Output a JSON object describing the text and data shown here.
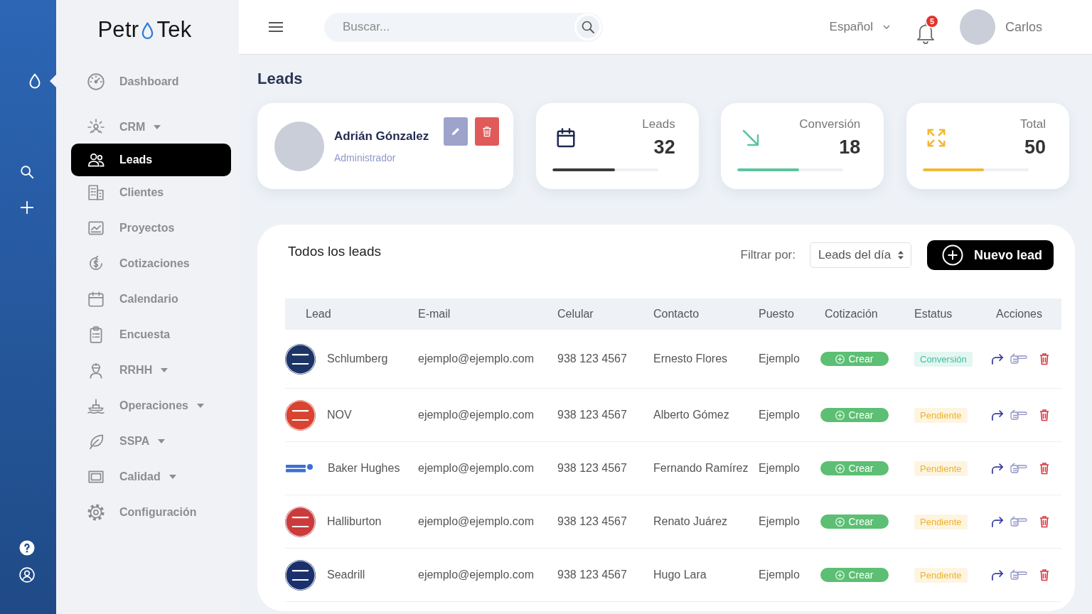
{
  "rail_items": [
    {
      "selected": true
    },
    {
      "selected": false
    },
    {
      "selected": false
    },
    {
      "selected": false
    },
    {
      "selected": false
    }
  ],
  "logo": {
    "left": "Petr",
    "right": "Tek"
  },
  "sidebar": {
    "items": [
      {
        "label": "Dashboard",
        "selected": false,
        "submenu": false
      },
      {
        "label": "CRM",
        "selected": false,
        "submenu": true
      },
      {
        "label": "Leads",
        "selected": true,
        "submenu": false
      },
      {
        "label": "Clientes",
        "selected": false,
        "submenu": false
      },
      {
        "label": "Proyectos",
        "selected": false,
        "submenu": false
      },
      {
        "label": "Cotizaciones",
        "selected": false,
        "submenu": false
      },
      {
        "label": "Calendario",
        "selected": false,
        "submenu": false
      },
      {
        "label": "Encuesta",
        "selected": false,
        "submenu": false
      },
      {
        "label": "RRHH",
        "selected": false,
        "submenu": true
      },
      {
        "label": "Operaciones",
        "selected": false,
        "submenu": true
      },
      {
        "label": "SSPA",
        "selected": false,
        "submenu": true
      },
      {
        "label": "Calidad",
        "selected": false,
        "submenu": true
      },
      {
        "label": "Configuración",
        "selected": false,
        "submenu": false
      }
    ]
  },
  "header": {
    "search": {
      "placeholder": "Buscar..."
    },
    "language": "Español",
    "notifications": {
      "count": "5"
    },
    "user": {
      "name": "Carlos"
    }
  },
  "page_title": "Leads",
  "profile_card": {
    "name": "Adrián Gónzalez",
    "role": "Administrador"
  },
  "stats": [
    {
      "label": "Leads",
      "value": "32",
      "level": 0.59,
      "color": "#3a3a3a"
    },
    {
      "label": "Conversión",
      "value": "18",
      "level": 0.58,
      "color": "#5cc59c"
    },
    {
      "label": "Total",
      "value": "50",
      "level": 0.58,
      "color": "#f2b93b"
    }
  ],
  "leads_panel": {
    "title": "Todos los leads",
    "filter": {
      "label": "Filtrar por:",
      "value": "Leads del día"
    },
    "new_button": "Nuevo lead"
  },
  "table": {
    "columns": [
      "Lead",
      "E-mail",
      "Celular",
      "Contacto",
      "Puesto",
      "Cotización",
      "Estatus",
      "Acciones"
    ],
    "rows": [
      {
        "logo": {
          "kind": "disc",
          "color": "#1c3566"
        },
        "lead": "Schlumberg",
        "email": "ejemplo@ejemplo.com",
        "phone": "938 123 4567",
        "contact": "Ernesto Flores",
        "position": "Ejemplo",
        "quote_action": "Crear",
        "status": {
          "label": "Conversión",
          "kind": "converted"
        }
      },
      {
        "logo": {
          "kind": "disc",
          "color": "#d9432f"
        },
        "lead": "NOV",
        "email": "ejemplo@ejemplo.com",
        "phone": "938 123 4567",
        "contact": "Alberto Gómez",
        "position": "Ejemplo",
        "quote_action": "Crear",
        "status": {
          "label": "Pendiente",
          "kind": "pending"
        }
      },
      {
        "logo": {
          "kind": "wordmark",
          "color": "#3b6fd4"
        },
        "lead": "Baker Hughes",
        "email": "ejemplo@ejemplo.com",
        "phone": "938 123 4567",
        "contact": "Fernando Ramírez",
        "position": "Ejemplo",
        "quote_action": "Crear",
        "status": {
          "label": "Pendiente",
          "kind": "pending"
        }
      },
      {
        "logo": {
          "kind": "disc",
          "color": "#cc3b3b"
        },
        "lead": "Halliburton",
        "email": "ejemplo@ejemplo.com",
        "phone": "938 123 4567",
        "contact": "Renato Juárez",
        "position": "Ejemplo",
        "quote_action": "Crear",
        "status": {
          "label": "Pendiente",
          "kind": "pending"
        }
      },
      {
        "logo": {
          "kind": "disc",
          "color": "#1a2f6b"
        },
        "lead": "Seadrill",
        "email": "ejemplo@ejemplo.com",
        "phone": "938 123 4567",
        "contact": "Hugo Lara",
        "position": "Ejemplo",
        "quote_action": "Crear",
        "status": {
          "label": "Pendiente",
          "kind": "pending"
        }
      }
    ]
  }
}
